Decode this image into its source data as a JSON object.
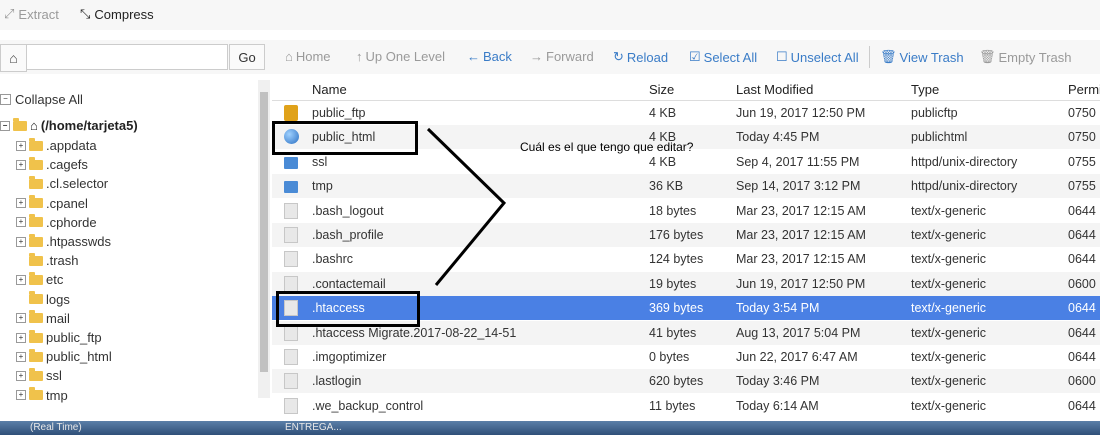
{
  "toolbar": {
    "extract_label": "Extract",
    "compress_label": "Compress"
  },
  "search": {
    "go_label": "Go",
    "path_value": ""
  },
  "actions": [
    {
      "label": "Home",
      "enabled": false
    },
    {
      "label": "Up One Level",
      "enabled": false
    },
    {
      "label": "Back",
      "enabled": true
    },
    {
      "label": "Forward",
      "enabled": false
    },
    {
      "label": "Reload",
      "enabled": true
    },
    {
      "label": "Select All",
      "enabled": true
    },
    {
      "label": "Unselect All",
      "enabled": true
    },
    {
      "label": "View Trash",
      "enabled": true
    },
    {
      "label": "Empty Trash",
      "enabled": false
    }
  ],
  "sidebar": {
    "collapse_label": "Collapse All",
    "root_label": "(/home/tarjeta5)",
    "items": [
      {
        "label": ".appdata",
        "expandable": true
      },
      {
        "label": ".cagefs",
        "expandable": true
      },
      {
        "label": ".cl.selector",
        "expandable": false
      },
      {
        "label": ".cpanel",
        "expandable": true
      },
      {
        "label": ".cphorde",
        "expandable": true
      },
      {
        "label": ".htpasswds",
        "expandable": true
      },
      {
        "label": ".trash",
        "expandable": false
      },
      {
        "label": "etc",
        "expandable": true
      },
      {
        "label": "logs",
        "expandable": false
      },
      {
        "label": "mail",
        "expandable": true
      },
      {
        "label": "public_ftp",
        "expandable": true
      },
      {
        "label": "public_html",
        "expandable": true
      },
      {
        "label": "ssl",
        "expandable": true
      },
      {
        "label": "tmp",
        "expandable": true
      }
    ]
  },
  "table": {
    "columns": [
      "Name",
      "Size",
      "Last Modified",
      "Type",
      "Permi"
    ],
    "rows": [
      {
        "name": "public_ftp",
        "size": "4 KB",
        "modified": "Jun 19, 2017 12:50 PM",
        "type": "publicftp",
        "perm": "0750",
        "icon": "public-ftp-icon"
      },
      {
        "name": "public_html",
        "size": "4 KB",
        "modified": "Today 4:45 PM",
        "type": "publichtml",
        "perm": "0750",
        "icon": "globe-icon"
      },
      {
        "name": "ssl",
        "size": "4 KB",
        "modified": "Sep 4, 2017 11:55 PM",
        "type": "httpd/unix-directory",
        "perm": "0755",
        "icon": "folder-icon"
      },
      {
        "name": "tmp",
        "size": "36 KB",
        "modified": "Sep 14, 2017 3:12 PM",
        "type": "httpd/unix-directory",
        "perm": "0755",
        "icon": "folder-icon"
      },
      {
        "name": ".bash_logout",
        "size": "18 bytes",
        "modified": "Mar 23, 2017 12:15 AM",
        "type": "text/x-generic",
        "perm": "0644",
        "icon": "file-icon"
      },
      {
        "name": ".bash_profile",
        "size": "176 bytes",
        "modified": "Mar 23, 2017 12:15 AM",
        "type": "text/x-generic",
        "perm": "0644",
        "icon": "file-icon"
      },
      {
        "name": ".bashrc",
        "size": "124 bytes",
        "modified": "Mar 23, 2017 12:15 AM",
        "type": "text/x-generic",
        "perm": "0644",
        "icon": "file-icon"
      },
      {
        "name": ".contactemail",
        "size": "19 bytes",
        "modified": "Jun 19, 2017 12:50 PM",
        "type": "text/x-generic",
        "perm": "0600",
        "icon": "file-icon"
      },
      {
        "name": ".htaccess",
        "size": "369 bytes",
        "modified": "Today 3:54 PM",
        "type": "text/x-generic",
        "perm": "0644",
        "icon": "file-icon",
        "selected": true
      },
      {
        "name": ".htaccess Migrate.2017-08-22_14-51",
        "size": "41 bytes",
        "modified": "Aug 13, 2017 5:04 PM",
        "type": "text/x-generic",
        "perm": "0644",
        "icon": "file-icon"
      },
      {
        "name": ".imgoptimizer",
        "size": "0 bytes",
        "modified": "Jun 22, 2017 6:47 AM",
        "type": "text/x-generic",
        "perm": "0644",
        "icon": "file-icon"
      },
      {
        "name": ".lastlogin",
        "size": "620 bytes",
        "modified": "Today 3:46 PM",
        "type": "text/x-generic",
        "perm": "0600",
        "icon": "file-icon"
      },
      {
        "name": ".we_backup_control",
        "size": "11 bytes",
        "modified": "Today 6:14 AM",
        "type": "text/x-generic",
        "perm": "0644",
        "icon": "file-icon"
      }
    ]
  },
  "annotation": {
    "question": "Cuál es el que tengo que editar?"
  },
  "taskbar": {
    "left_label": "(Real Time)",
    "mid_label": "ENTREGA..."
  },
  "colors": {
    "accent": "#3a7cc7",
    "selected_row": "#4a80e4",
    "folder": "#f0c24b"
  }
}
